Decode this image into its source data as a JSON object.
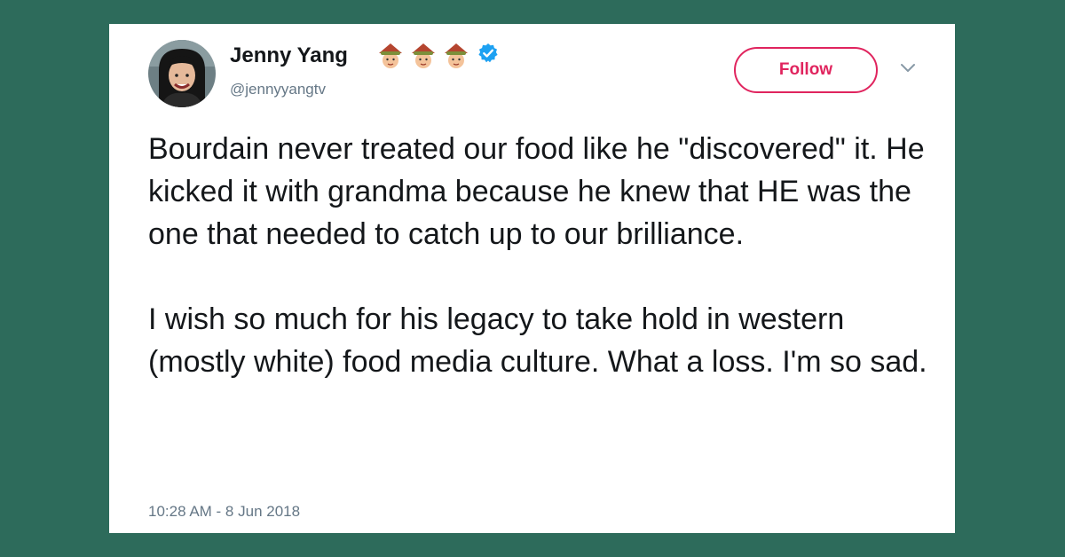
{
  "tweet": {
    "author_name": "Jenny Yang",
    "handle": "@jennyyangtv",
    "follow_label": "Follow",
    "paragraphs": [
      "Bourdain never treated our food like he \"discovered\" it. He kicked it with grandma because he knew that HE was the one that needed to catch up to our brilliance.",
      "I wish so much for his legacy to take hold in western (mostly white) food media culture. What a loss. I'm so sad."
    ],
    "timestamp": "10:28 AM - 8 Jun 2018",
    "name_badges": [
      "rice-hat-emoji-icon",
      "rice-hat-emoji-icon",
      "rice-hat-emoji-icon"
    ],
    "verified_badge": "verified-badge-icon",
    "menu_icon": "chevron-down-icon"
  },
  "colors": {
    "background": "#2d6b5b",
    "card": "#ffffff",
    "text": "#14171a",
    "secondary_text": "#657786",
    "follow_accent": "#e0245e",
    "verified": "#1da1f2"
  }
}
